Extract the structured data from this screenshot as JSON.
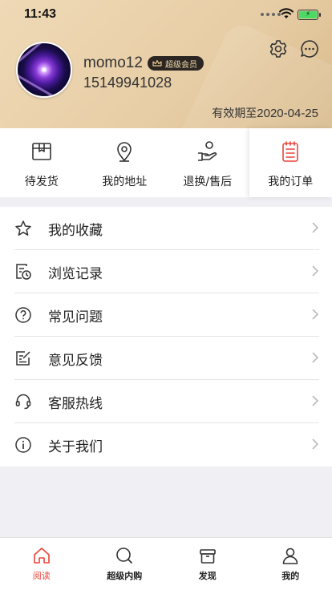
{
  "status_bar": {
    "time": "11:43"
  },
  "profile": {
    "username": "momo12",
    "vip_label": "超级会员",
    "phone": "15149941028",
    "expire_prefix": "有效期至",
    "expire_date": "2020-04-25"
  },
  "header_icons": {
    "settings": "gear-icon",
    "messages": "chat-icon"
  },
  "quick_actions": [
    {
      "label": "待发货",
      "icon": "box-icon"
    },
    {
      "label": "我的地址",
      "icon": "location-pin-icon"
    },
    {
      "label": "退换/售后",
      "icon": "hand-return-icon"
    },
    {
      "label": "我的订单",
      "icon": "order-list-icon"
    }
  ],
  "menu": [
    {
      "label": "我的收藏",
      "icon": "star-icon"
    },
    {
      "label": "浏览记录",
      "icon": "history-icon"
    },
    {
      "label": "常见问题",
      "icon": "question-circle-icon"
    },
    {
      "label": "意见反馈",
      "icon": "feedback-edit-icon"
    },
    {
      "label": "客服热线",
      "icon": "headset-icon"
    },
    {
      "label": "关于我们",
      "icon": "info-circle-icon"
    }
  ],
  "tabs": [
    {
      "label": "阅读",
      "icon": "home-icon",
      "active": true
    },
    {
      "label": "超级内购",
      "icon": "search-icon"
    },
    {
      "label": "发现",
      "icon": "gift-box-icon"
    },
    {
      "label": "我的",
      "icon": "person-icon"
    }
  ],
  "colors": {
    "accent": "#e8463c",
    "header_gold": "#e7cda5",
    "vip_badge_bg": "#2b2622"
  }
}
